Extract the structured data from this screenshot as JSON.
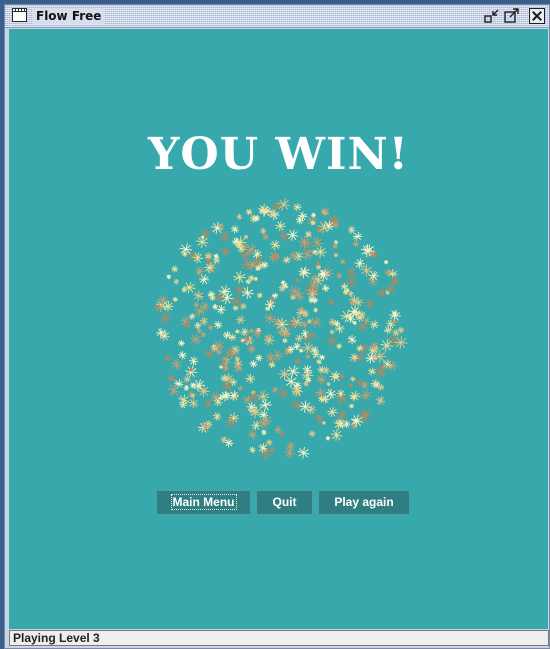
{
  "window": {
    "title": "Flow Free",
    "controls": [
      "iconify-icon",
      "maximize-icon",
      "close-icon"
    ]
  },
  "game": {
    "win_title": "YOU WIN!",
    "background_color": "#37a8ab",
    "confetti_colors": [
      "#f2e29a",
      "#e6c98a",
      "#c9a070",
      "#b58a5f",
      "#fbf3c4"
    ]
  },
  "buttons": {
    "main_menu": "Main Menu",
    "quit": "Quit",
    "play_again": "Play again"
  },
  "status": {
    "text": "Playing Level 3"
  }
}
